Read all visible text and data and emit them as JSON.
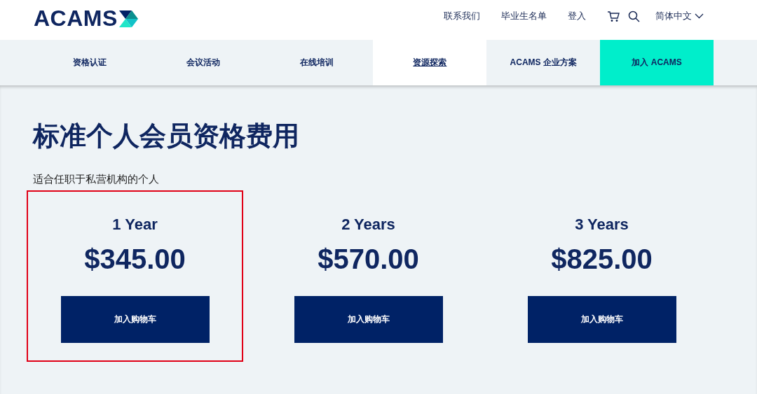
{
  "header": {
    "logo": "ACAMS",
    "links": [
      "联系我们",
      "毕业生名单",
      "登入"
    ],
    "language": "简体中文"
  },
  "nav": [
    {
      "label": "资格认证",
      "selected": false,
      "kind": "tab"
    },
    {
      "label": "会议活动",
      "selected": false,
      "kind": "tab"
    },
    {
      "label": "在线培训",
      "selected": false,
      "kind": "tab"
    },
    {
      "label": "资源探索",
      "selected": true,
      "kind": "tab"
    },
    {
      "label": "ACAMS 企业方案",
      "selected": false,
      "kind": "tab"
    },
    {
      "label": "加入 ACAMS",
      "selected": false,
      "kind": "cta"
    }
  ],
  "title": "标准个人会员资格费用",
  "subtitle": "适合任职于私营机构的个人",
  "plans": [
    {
      "term": "1 Year",
      "price": "$345.00",
      "button": "加入购物车",
      "highlighted": true
    },
    {
      "term": "2 Years",
      "price": "$570.00",
      "button": "加入购物车",
      "highlighted": false
    },
    {
      "term": "3 Years",
      "price": "$825.00",
      "button": "加入购物车",
      "highlighted": false
    }
  ]
}
